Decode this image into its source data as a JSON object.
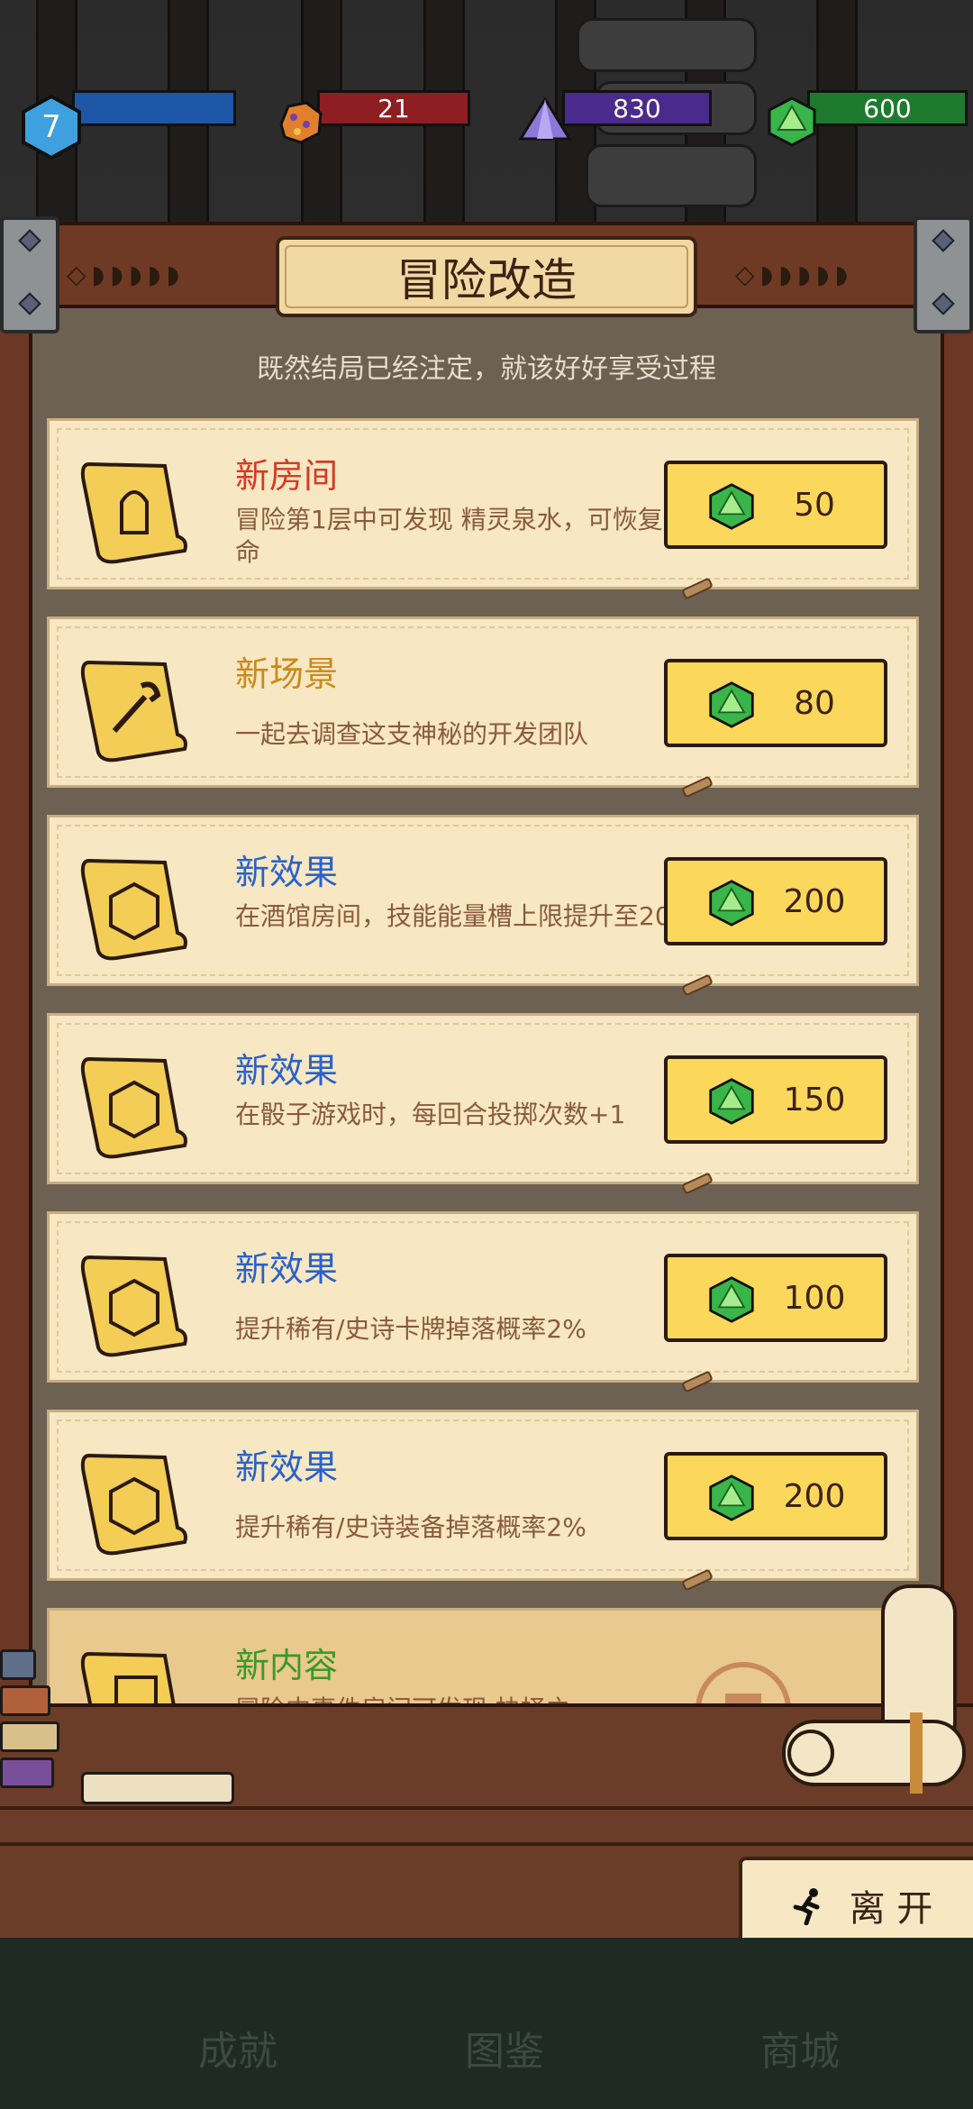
{
  "resources": {
    "level": "7",
    "ore": "21",
    "crystal": "830",
    "gem": "600"
  },
  "header": {
    "title": "冒险改造",
    "subtitle": "既然结局已经注定，就该好好享受过程",
    "decor_left": "◇◗◗◗◗◗",
    "decor_right": "◇◗◗◗◗◗"
  },
  "cards": [
    {
      "title": "新房间",
      "title_color": "red",
      "desc": "冒险第1层中可发现 精灵泉水，可恢复生命",
      "price": "50"
    },
    {
      "title": "新场景",
      "title_color": "orange",
      "desc": "一起去调查这支神秘的开发团队",
      "price": "80"
    },
    {
      "title": "新效果",
      "title_color": "blue",
      "desc": "在酒馆房间，技能能量槽上限提升至20",
      "price": "200"
    },
    {
      "title": "新效果",
      "title_color": "blue",
      "desc": "在骰子游戏时，每回合投掷次数+1",
      "price": "150"
    },
    {
      "title": "新效果",
      "title_color": "blue",
      "desc": "提升稀有/史诗卡牌掉落概率2%",
      "price": "100"
    },
    {
      "title": "新效果",
      "title_color": "blue",
      "desc": "提升稀有/史诗装备掉落概率2%",
      "price": "200"
    },
    {
      "title": "新内容",
      "title_color": "green",
      "desc": "冒险中事件房间可发现 抉择之",
      "price": ""
    }
  ],
  "leave_button": "离 开",
  "nav": [
    "成就",
    "图鉴",
    "商城"
  ],
  "colors": {
    "red": "#d63a24",
    "orange": "#c98a1a",
    "blue": "#2a62c8",
    "green": "#3a9a24",
    "button": "#fbd75c",
    "parchment": "#f7e7c3"
  }
}
